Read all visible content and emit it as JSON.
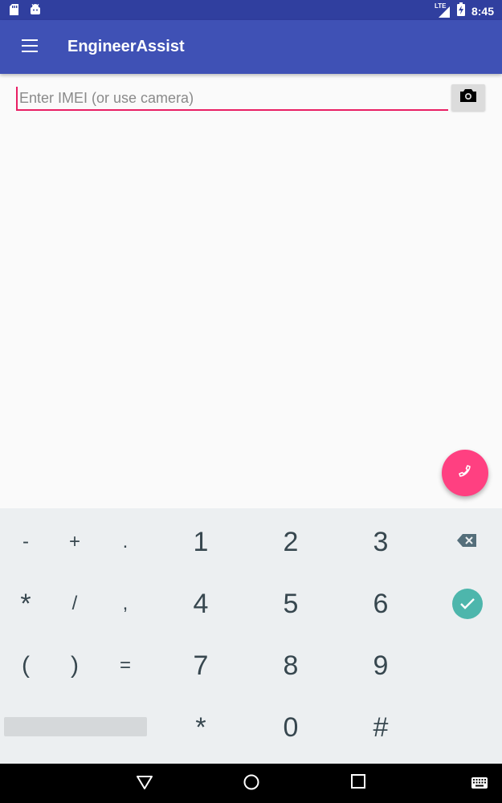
{
  "status_bar": {
    "time": "8:45",
    "network": "LTE",
    "icons": [
      "sd-card-icon",
      "android-icon",
      "signal-icon",
      "battery-charging-icon"
    ]
  },
  "app_bar": {
    "title": "EngineerAssist",
    "menu_icon": "hamburger-menu-icon"
  },
  "imei_field": {
    "placeholder": "Enter IMEI (or use camera)",
    "value": "",
    "camera_icon": "camera-icon"
  },
  "fab": {
    "icon": "phone-icon",
    "color": "#ff4081"
  },
  "keyboard": {
    "symbol_rows": [
      [
        "-",
        "+",
        "."
      ],
      [
        "*",
        "/",
        ","
      ],
      [
        "(",
        ")",
        "="
      ]
    ],
    "digit_rows": [
      [
        "1",
        "2",
        "3"
      ],
      [
        "4",
        "5",
        "6"
      ],
      [
        "7",
        "8",
        "9"
      ],
      [
        "*",
        "0",
        "#"
      ]
    ],
    "action_icons": [
      "backspace-icon",
      "done-check-icon"
    ]
  },
  "nav_bar": {
    "icons": [
      "back-icon",
      "home-icon",
      "recents-icon",
      "keyboard-switch-icon"
    ]
  },
  "colors": {
    "primary": "#3f51b5",
    "primary_dark": "#303f9f",
    "accent": "#ff4081",
    "keyboard_bg": "#eceff1",
    "confirm": "#4db6ac"
  }
}
